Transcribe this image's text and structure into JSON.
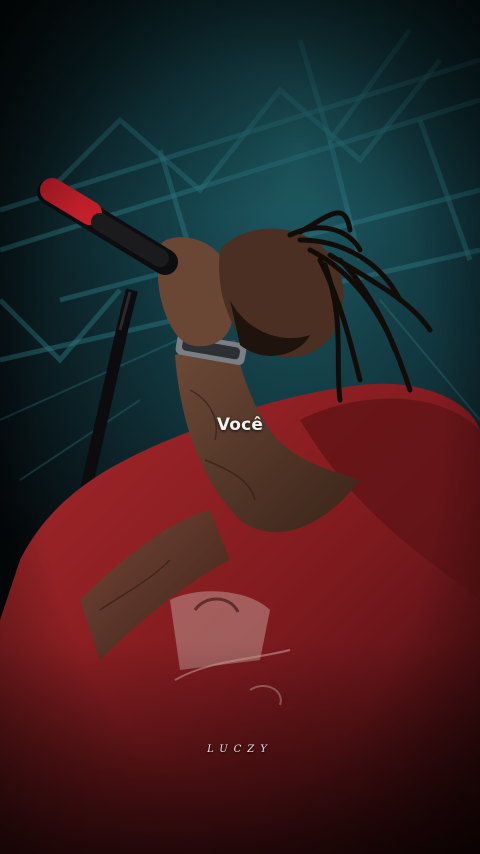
{
  "video": {
    "lyric_text": "Você",
    "watermark_text": "LUCZY"
  },
  "colors": {
    "stage_teal": "#1e5a63",
    "shirt_red": "#8e1f22",
    "skin": "#5a3a2c",
    "background": "#05080a"
  },
  "scene_elements": {
    "performer": "performer-singing",
    "microphone": "microphone",
    "mic_stand": "microphone-stand",
    "truss": "stage-lighting-truss"
  }
}
